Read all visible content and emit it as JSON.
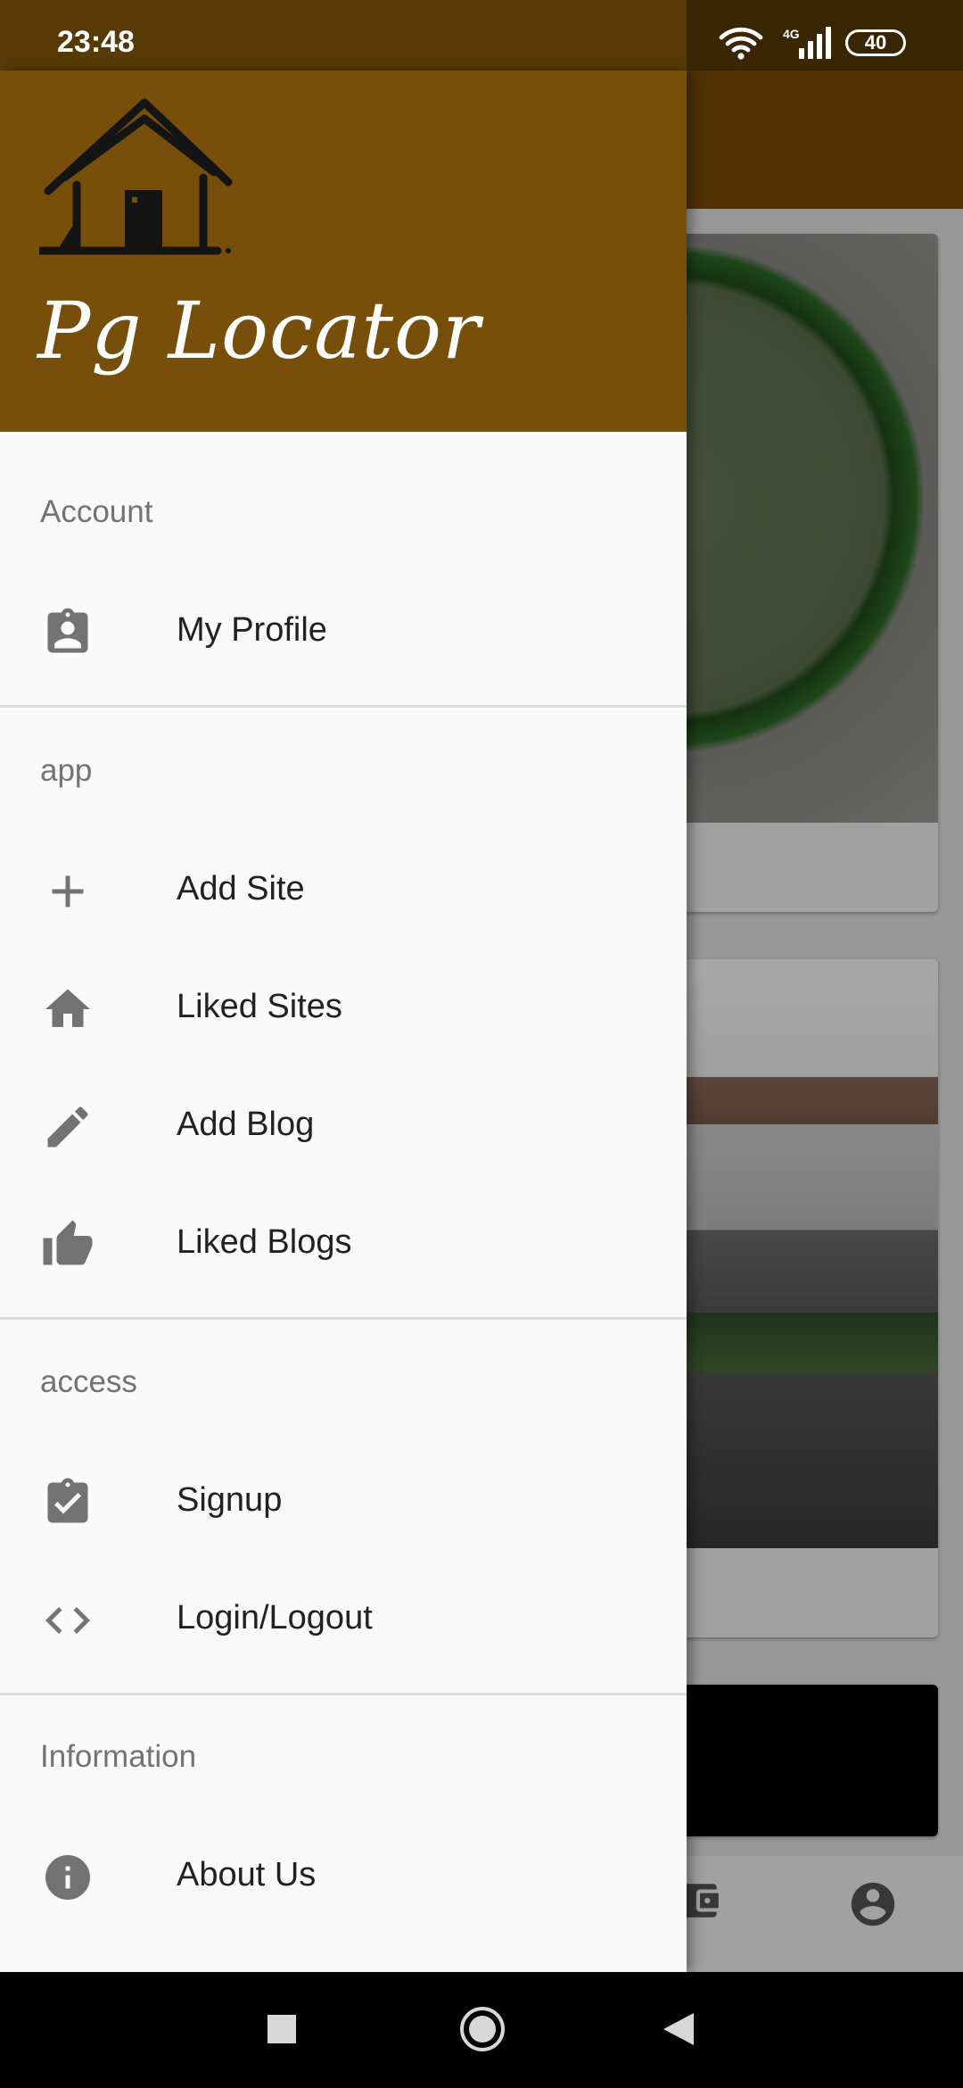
{
  "status_bar": {
    "time": "23:48",
    "network": "4G",
    "battery": "40"
  },
  "drawer": {
    "app_name": "Pg Locator",
    "sections": [
      {
        "title": "Account",
        "items": [
          {
            "label": "My Profile",
            "icon": "account-box-icon"
          }
        ]
      },
      {
        "title": "app",
        "items": [
          {
            "label": "Add Site",
            "icon": "plus-icon"
          },
          {
            "label": "Liked Sites",
            "icon": "home-icon"
          },
          {
            "label": "Add Blog",
            "icon": "pencil-icon"
          },
          {
            "label": "Liked Blogs",
            "icon": "thumb-up-icon"
          }
        ]
      },
      {
        "title": "access",
        "items": [
          {
            "label": "Signup",
            "icon": "clipboard-check-icon"
          },
          {
            "label": "Login/Logout",
            "icon": "code-icon"
          }
        ]
      },
      {
        "title": "Information",
        "items": [
          {
            "label": "About Us",
            "icon": "info-icon"
          }
        ]
      }
    ]
  },
  "colors": {
    "header": "#774f0a",
    "status_bar": "#573a06",
    "icon": "#737373",
    "text": "#212121"
  }
}
